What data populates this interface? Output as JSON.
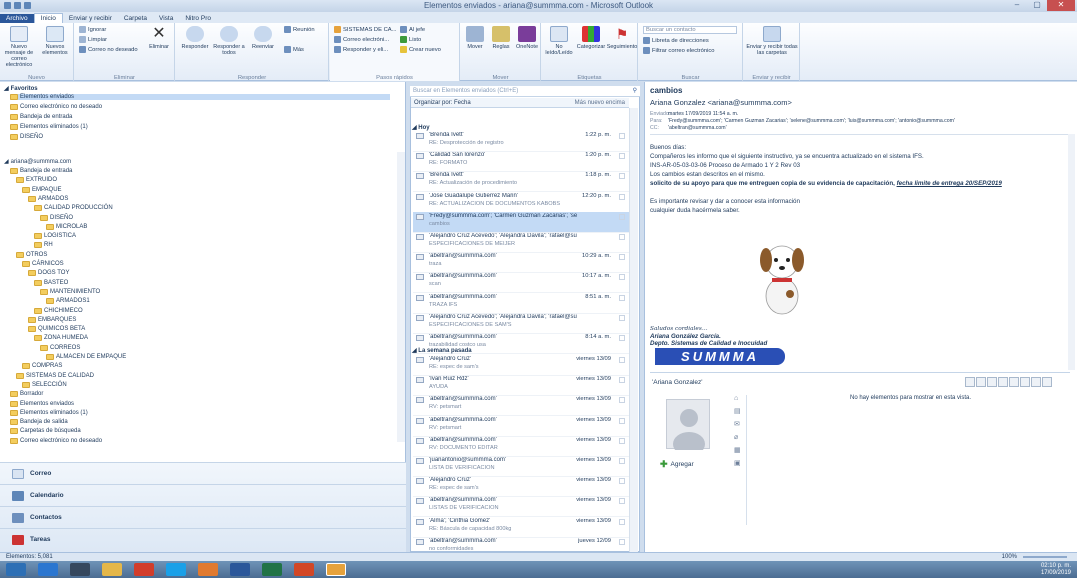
{
  "window": {
    "title": "Elementos enviados - ariana@summma.com - Microsoft Outlook",
    "min": "–",
    "max": "▢",
    "close": "✕"
  },
  "tabs": [
    "Archivo",
    "Inicio",
    "Enviar y recibir",
    "Carpeta",
    "Vista",
    "Nitro Pro"
  ],
  "ribbon": {
    "new_email": "Nuevo mensaje de correo electrónico",
    "new_items": "Nuevos elementos",
    "group_new": "Nuevo",
    "ignore": "Ignorar",
    "clean": "Limpiar",
    "junk": "Correo no deseado",
    "delete": "Eliminar",
    "group_delete": "Eliminar",
    "reply": "Responder",
    "reply_all": "Responder a todos",
    "forward": "Reenviar",
    "meeting": "Reunión",
    "more": "Más",
    "group_respond": "Responder",
    "quick1": "SISTEMAS DE CA...",
    "quick2": "Correo electróni...",
    "quick3": "Responder y eli...",
    "quick4": "Al jefe",
    "quick5": "Listo",
    "quick6": "Crear nuevo",
    "group_quick": "Pasos rápidos",
    "move": "Mover",
    "rules": "Reglas",
    "onenote": "OneNote",
    "group_move": "Mover",
    "unread": "No leído/Leído",
    "categorize": "Categorizar",
    "followup": "Seguimiento",
    "group_tags": "Etiquetas",
    "find_contact": "Buscar un contacto",
    "address_book": "Libreta de direcciones",
    "filter": "Filtrar correo electrónico",
    "group_find": "Buscar",
    "send_receive": "Enviar y recibir todas las carpetas",
    "group_send": "Enviar y recibir"
  },
  "nav": {
    "favorites": "Favoritos",
    "fav_items": [
      "Elementos enviados",
      "Correo electrónico no deseado",
      "Bandeja de entrada",
      "Elementos eliminados (1)",
      "DISEÑO"
    ],
    "account": "ariana@summma.com",
    "tree": [
      {
        "label": "Bandeja de entrada",
        "indent": 1
      },
      {
        "label": "EXTRUIDO",
        "indent": 2
      },
      {
        "label": "EMPAQUE",
        "indent": 3
      },
      {
        "label": "ARMADOS",
        "indent": 4
      },
      {
        "label": "CALIDAD PRODUCCIÓN",
        "indent": 5
      },
      {
        "label": "DISEÑO",
        "indent": 6
      },
      {
        "label": "MICROLAB",
        "indent": 7
      },
      {
        "label": "LOGISTICA",
        "indent": 5
      },
      {
        "label": "RH",
        "indent": 5
      },
      {
        "label": "OTROS",
        "indent": 2
      },
      {
        "label": "CÁRNICOS",
        "indent": 3
      },
      {
        "label": "DOGS TOY",
        "indent": 4
      },
      {
        "label": "BASTEO",
        "indent": 5
      },
      {
        "label": "MANTENIMIENTO",
        "indent": 6
      },
      {
        "label": "ARMADOS1",
        "indent": 7
      },
      {
        "label": "CHICHIMECO",
        "indent": 5
      },
      {
        "label": "EMBARQUES",
        "indent": 4
      },
      {
        "label": "QUIMICOS BETA",
        "indent": 4
      },
      {
        "label": "ZONA HUMEDA",
        "indent": 5
      },
      {
        "label": "CORREOS",
        "indent": 6
      },
      {
        "label": "ALMACEN DE EMPAQUE",
        "indent": 7
      },
      {
        "label": "COMPRAS",
        "indent": 3
      },
      {
        "label": "SISTEMAS DE CALIDAD",
        "indent": 2
      },
      {
        "label": "SELECCIÓN",
        "indent": 3
      },
      {
        "label": "Borrador",
        "indent": 1
      },
      {
        "label": "Elementos enviados",
        "indent": 1
      },
      {
        "label": "Elementos eliminados (1)",
        "indent": 1
      },
      {
        "label": "Bandeja de salida",
        "indent": 1
      },
      {
        "label": "Carpetas de búsqueda",
        "indent": 1
      },
      {
        "label": "Correo electrónico no deseado",
        "indent": 1
      }
    ],
    "buttons": [
      "Correo",
      "Calendario",
      "Contactos",
      "Tareas"
    ]
  },
  "list": {
    "search_placeholder": "Buscar en Elementos enviados (Ctrl+E)",
    "sort_by": "Organizar por: Fecha",
    "sort_order": "Más nuevo encima",
    "group_today": "Hoy",
    "group_last_week": "La semana pasada",
    "today": [
      {
        "from": "'Brenda Ivett'",
        "subject": "RE: Desprotección de registro",
        "date": "1:22 p. m."
      },
      {
        "from": "'Calidad San lorenzo'",
        "subject": "RE: FORMATO",
        "date": "1:20 p. m."
      },
      {
        "from": "'Brenda Ivett'",
        "subject": "RE: Actualización de procedimiento",
        "date": "1:18 p. m."
      },
      {
        "from": "'Jose Guadalupe Gutierrez Marin'",
        "subject": "RE: ACTUALIZACION DE DOCUMENTOS KABOBS",
        "date": "12:20 p. m."
      },
      {
        "from": "'Fredy@summma.com'; 'Carmen Guzman Zacarias'; 'selene@s...",
        "subject": "cambios",
        "date": ""
      },
      {
        "from": "'Alejandro Cruz Acevedo'; 'Alejandra Davila'; 'rafael@summm...",
        "subject": "ESPECIFICACIONES DE MEIJER",
        "date": ""
      },
      {
        "from": "'abeltran@summma.com'",
        "subject": "traza",
        "date": "10:29 a. m."
      },
      {
        "from": "'abeltran@summma.com'",
        "subject": "scan",
        "date": "10:17 a. m."
      },
      {
        "from": "'abeltran@summma.com'",
        "subject": "TRAZA IFS",
        "date": "8:51 a. m."
      },
      {
        "from": "'Alejandro Cruz Acevedo'; 'Alejandra Davila'; 'rafael@summm...",
        "subject": "ESPECIFICACIONES DE SAM'S",
        "date": ""
      },
      {
        "from": "'abeltran@summma.com'",
        "subject": "trazabilidad costco usa",
        "date": "8:14 a. m."
      }
    ],
    "last_week": [
      {
        "from": "'Alejandro Cruz'",
        "subject": "RE: espec de sam's",
        "date": "viernes 13/09"
      },
      {
        "from": "'Ivan Ruiz Rdz'",
        "subject": "AYUDA",
        "date": "viernes 13/09"
      },
      {
        "from": "'abeltran@summma.com'",
        "subject": "RV: petsmart",
        "date": "viernes 13/09"
      },
      {
        "from": "'abeltran@summma.com'",
        "subject": "RV: petsmart",
        "date": "viernes 13/09"
      },
      {
        "from": "'abeltran@summma.com'",
        "subject": "RV: DOCUMENTO EDITAR",
        "date": "viernes 13/09"
      },
      {
        "from": "'juanantonio@summma.com'",
        "subject": "LISTA DE VERIFICACIÓN",
        "date": "viernes 13/09"
      },
      {
        "from": "'Alejandro Cruz'",
        "subject": "RE: espec de sam's",
        "date": "viernes 13/09"
      },
      {
        "from": "'abeltran@summma.com'",
        "subject": "LISTAS DE VERIFICACIÓN",
        "date": "viernes 13/09"
      },
      {
        "from": "'Alma'; 'Cinthia Gomez'",
        "subject": "RE: Báscula de capacidad 800kg",
        "date": "viernes 13/09"
      },
      {
        "from": "'abeltran@summma.com'",
        "subject": "no conformidades",
        "date": "jueves 12/09"
      }
    ]
  },
  "reading": {
    "subject": "cambios",
    "from": "Ariana Gonzalez <ariana@summma.com>",
    "sent_label": "Enviado:",
    "sent": "martes 17/09/2019 11:54 a. m.",
    "to_label": "Para:",
    "to": "'Fredy@summma.com'; 'Carmen Guzman Zacarias'; 'selene@summma.com'; 'luis@summma.com'; 'antonio@summma.com'",
    "cc_label": "CC:",
    "cc": "'abeltran@summma.com'",
    "body": [
      "Buenos días:",
      "Compañeros les informo que el siguiente instructivo, ya se encuentra actualizado en el sistema IFS.",
      "INS-AR-05-03-03-06 Proceso de Armado 1 Y 2 Rev 03",
      "Los cambios estan descritos en el mismo."
    ],
    "bold_line": "solicito de su apoyo para que me entreguen copia de su evidencia de capacitación,",
    "deadline": "fecha limite de entrega 20/SEP/2019",
    "body2": [
      "Es importante revisar y dar a conocer esta información",
      "cualquier duda hacérmela saber."
    ],
    "sig1": "Saludos cordiales…",
    "sig2": "Ariana González García.",
    "sig3": "Depto. Sistemas de Calidad e Inocuidad",
    "logo": "SUMMMA"
  },
  "people": {
    "name": "'Ariana Gonzalez'",
    "empty": "No hay elementos para mostrar en esta vista.",
    "add": "Agregar"
  },
  "status": {
    "items": "Elementos: 5,081",
    "zoom": "100%"
  },
  "taskbar": {
    "time": "02:10 p. m.",
    "date": "17/09/2019"
  },
  "colors": {
    "accent": "#2b579a",
    "selection": "#c3daf5",
    "logo_blue": "#2a4fb5"
  }
}
